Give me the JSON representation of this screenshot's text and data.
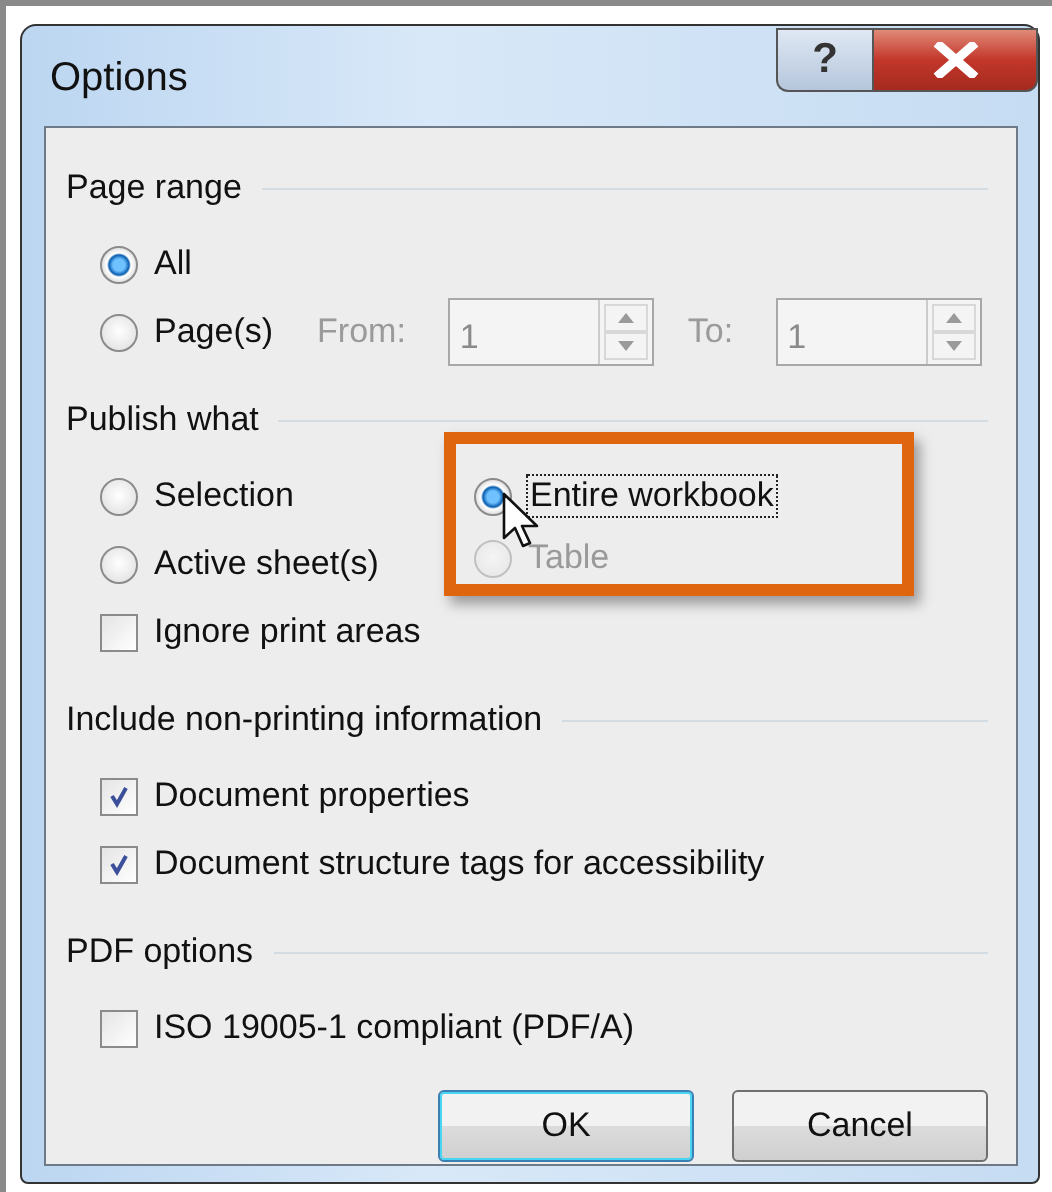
{
  "window": {
    "title": "Options",
    "help_button": "?"
  },
  "page_range": {
    "title": "Page range",
    "options": [
      {
        "label": "All",
        "selected": true
      },
      {
        "label": "Page(s)",
        "selected": false
      }
    ],
    "from": {
      "label": "From:",
      "value": "1",
      "disabled": true
    },
    "to": {
      "label": "To:",
      "value": "1",
      "disabled": true
    }
  },
  "publish_what": {
    "title": "Publish what",
    "left_options": [
      {
        "label": "Selection",
        "selected": false,
        "disabled": false,
        "focused": false
      },
      {
        "label": "Active sheet(s)",
        "selected": false,
        "disabled": false,
        "focused": false
      }
    ],
    "right_options": [
      {
        "label": "Entire workbook",
        "selected": true,
        "disabled": false,
        "focused": true
      },
      {
        "label": "Table",
        "selected": false,
        "disabled": true,
        "focused": false
      }
    ],
    "right_highlighted": true,
    "ignore_print_areas": {
      "label": "Ignore print areas",
      "checked": false
    }
  },
  "non_printing": {
    "title": "Include non-printing information",
    "checkboxes": [
      {
        "label": "Document properties",
        "checked": true
      },
      {
        "label": "Document structure tags for accessibility",
        "checked": true
      }
    ]
  },
  "pdf_options": {
    "title": "PDF options",
    "checkboxes": [
      {
        "label": "ISO 19005-1 compliant (PDF/A)",
        "checked": false
      }
    ]
  },
  "buttons": [
    {
      "label": "OK",
      "default": true
    },
    {
      "label": "Cancel",
      "default": false
    }
  ]
}
